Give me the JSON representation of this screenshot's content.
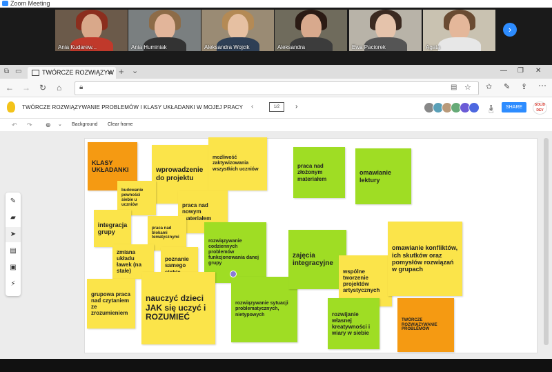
{
  "zoom": {
    "title": "Zoom Meeting"
  },
  "participants": [
    {
      "name": "Ania Kudarew...",
      "bg": "#6b5a4a",
      "hair": "#8b2e1e",
      "shirt": "#c0392b"
    },
    {
      "name": "Ania Huminiak",
      "bg": "#7a7f80",
      "hair": "#8d6c48",
      "shirt": "#333333"
    },
    {
      "name": "Aleksandra Wojcik",
      "bg": "#9a8b74",
      "hair": "#b48a55",
      "shirt": "#2e3f55"
    },
    {
      "name": "Aleksandra",
      "bg": "#6f6b5c",
      "hair": "#2b1b14",
      "shirt": "#3c3c3c"
    },
    {
      "name": "Ewa Paciorek",
      "bg": "#b8b3a8",
      "hair": "#3b2a21",
      "shirt": "#555555"
    },
    {
      "name": "Agata",
      "bg": "#c9c2b1",
      "hair": "#6a4b32",
      "shirt": "#e7e7e7"
    }
  ],
  "browser": {
    "tab_label": "TWÓRCZE ROZWIĄZYW",
    "add_tab": "+",
    "tab_menu": "⌄",
    "win_min": "—",
    "win_max": "❐",
    "win_close": "✕",
    "back": "←",
    "forward": "→",
    "reload": "↻",
    "home": "⌂"
  },
  "app": {
    "doc_title": "TWÓRCZE ROZWIĄZYWANIE PROBLEMÓW I KLASY UKŁADANKI W MOJEJ PRACY",
    "page_indicator": "1/2",
    "share_label": "SHARE",
    "logo_text": "SOLID DEV",
    "toolbar_background": "Background",
    "toolbar_clear": "Clear frame"
  },
  "notes": [
    {
      "text": "KLASY UKŁADANKI",
      "color": "o"
    },
    {
      "text": "wprowadzenie do projektu",
      "color": "y"
    },
    {
      "text": "możliwość zaktywizowania wszystkich uczniów",
      "color": "y"
    },
    {
      "text": "budowanie pewności siebie u uczniów",
      "color": "y"
    },
    {
      "text": "praca nad nowym materiałem",
      "color": "y"
    },
    {
      "text": "integracja grupy",
      "color": "y"
    },
    {
      "text": "praca nad blokami tematycznymi",
      "color": "y"
    },
    {
      "text": "rozwiązywanie codziennych problemów funkcjonowania danej grupy",
      "color": "g"
    },
    {
      "text": "zmiana układu ławek (na stałe)",
      "color": "y"
    },
    {
      "text": "poznanie samego siebie",
      "color": "y"
    },
    {
      "text": "grupowa praca nad czytaniem ze zrozumieniem",
      "color": "y"
    },
    {
      "text": "nauczyć dzieci JAK się uczyć i ROZUMIEĆ",
      "color": "y"
    },
    {
      "text": "rozwiązywanie sytuacji problematycznych, nietypowych",
      "color": "g"
    },
    {
      "text": "praca nad złożonym materiałem",
      "color": "g"
    },
    {
      "text": "omawianie lektury",
      "color": "g"
    },
    {
      "text": "zajęcia integracyjne",
      "color": "g"
    },
    {
      "text": "wspólne tworzenie projektów artystycznych",
      "color": "y"
    },
    {
      "text": "omawianie konfliktów, ich skutków oraz pomysłów rozwiązań w grupach",
      "color": "y"
    },
    {
      "text": "rozwijanie własnej kreatywności i wiary w siebie",
      "color": "g"
    },
    {
      "text": "TWÓRCZE ROZWIĄZYWANIE PROBLEMÓW",
      "color": "o"
    }
  ]
}
